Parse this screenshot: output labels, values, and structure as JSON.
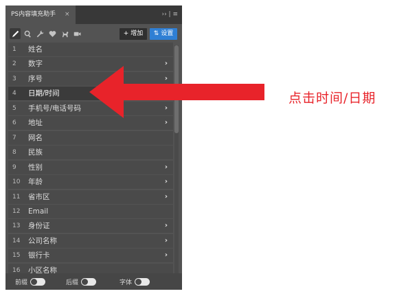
{
  "panel": {
    "tab_title": "PS内容填充助手",
    "tab_close": "×",
    "menu": "›› | ≡"
  },
  "toolbar": {
    "tools": [
      "pen-icon",
      "search-icon",
      "wrench-icon",
      "heart-icon",
      "dog-icon",
      "video-icon"
    ],
    "add_label": "+ 增加",
    "settings_label": "⇅ 设置"
  },
  "list": {
    "items": [
      {
        "num": "1",
        "label": "姓名",
        "arrow": ""
      },
      {
        "num": "2",
        "label": "数字",
        "arrow": "›"
      },
      {
        "num": "3",
        "label": "序号",
        "arrow": "›"
      },
      {
        "num": "4",
        "label": "日期/时间",
        "arrow": ""
      },
      {
        "num": "5",
        "label": "手机号/电话号码",
        "arrow": "›"
      },
      {
        "num": "6",
        "label": "地址",
        "arrow": "›"
      },
      {
        "num": "7",
        "label": "网名",
        "arrow": ""
      },
      {
        "num": "8",
        "label": "民族",
        "arrow": ""
      },
      {
        "num": "9",
        "label": "性别",
        "arrow": "›"
      },
      {
        "num": "10",
        "label": "年龄",
        "arrow": "›"
      },
      {
        "num": "11",
        "label": "省市区",
        "arrow": "›"
      },
      {
        "num": "12",
        "label": "Email",
        "arrow": ""
      },
      {
        "num": "13",
        "label": "身份证",
        "arrow": "›"
      },
      {
        "num": "14",
        "label": "公司名称",
        "arrow": "›"
      },
      {
        "num": "15",
        "label": "银行卡",
        "arrow": "›"
      },
      {
        "num": "16",
        "label": "小区名称",
        "arrow": ""
      }
    ],
    "selected_index": 3
  },
  "footer": {
    "prefix_label": "前缀",
    "suffix_label": "后缀",
    "font_label": "字体"
  },
  "annotation": {
    "text": "点击时间/日期",
    "color": "#e8232a"
  },
  "colors": {
    "panel_bg": "#535353",
    "accent_blue": "#2f7fd4",
    "arrow_red": "#e8232a"
  }
}
